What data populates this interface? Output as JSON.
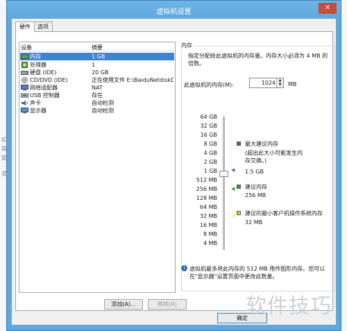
{
  "window": {
    "title": "虚拟机设置",
    "close_glyph": "✕"
  },
  "tabs": [
    {
      "label": "硬件"
    },
    {
      "label": "选项"
    }
  ],
  "device_list": {
    "headers": {
      "device": "设备",
      "summary": "摘要"
    },
    "rows": [
      {
        "name": "内存",
        "summary": "1 GB",
        "icon": "memory-icon"
      },
      {
        "name": "处理器",
        "summary": "1",
        "icon": "processor-icon"
      },
      {
        "name": "硬盘 (IDE)",
        "summary": "20 GB",
        "icon": "hard-disk-icon"
      },
      {
        "name": "CD/DVD (IDE)",
        "summary": "正在使用文件 E:\\BaiduNetdiskD...",
        "icon": "cd-dvd-icon"
      },
      {
        "name": "网络适配器",
        "summary": "NAT",
        "icon": "network-adapter-icon"
      },
      {
        "name": "USB 控制器",
        "summary": "存在",
        "icon": "usb-icon"
      },
      {
        "name": "声卡",
        "summary": "自动检测",
        "icon": "sound-card-icon"
      },
      {
        "name": "显示器",
        "summary": "自动检测",
        "icon": "display-icon"
      }
    ],
    "add_button": "添加(A)...",
    "remove_button": "移除(R)"
  },
  "memory": {
    "group_title": "内存",
    "description": "指定分配给此虚拟机的内存量。内存大小必须为 4 MB 的倍数。",
    "field_label": "此虚拟机的内存(M):",
    "value": "1024",
    "unit": "MB",
    "scale_ticks": [
      "64 GB",
      "32 GB",
      "16 GB",
      "8 GB",
      "4 GB",
      "2 GB",
      "1 GB",
      "512 MB",
      "256 MB",
      "128 MB",
      "64 MB",
      "32 MB",
      "16 MB",
      "8 MB",
      "4 MB"
    ],
    "legend": {
      "max": {
        "title": "最大建议内存",
        "note": "(超出此大小可能发生内存交换。)",
        "value": "1.5 GB",
        "color": "#3f6fa8"
      },
      "recommended": {
        "title": "建议内存",
        "value": "256 MB",
        "color": "#2e9a3a"
      },
      "min": {
        "title": "建议的最小客户机操作系统内存",
        "value": "32 MB",
        "color": "#d8d21f"
      }
    },
    "info_text": "虚拟机最多将此内存的 512 MB 用作图形内存。您可以在\"显示器\"设置页面中更改此数量。"
  },
  "footer": {
    "ok_button": "确定"
  },
  "watermark": "软件技巧",
  "background": {
    "left_chars": [
      "ID",
      "存",
      "定",
      "式"
    ]
  }
}
